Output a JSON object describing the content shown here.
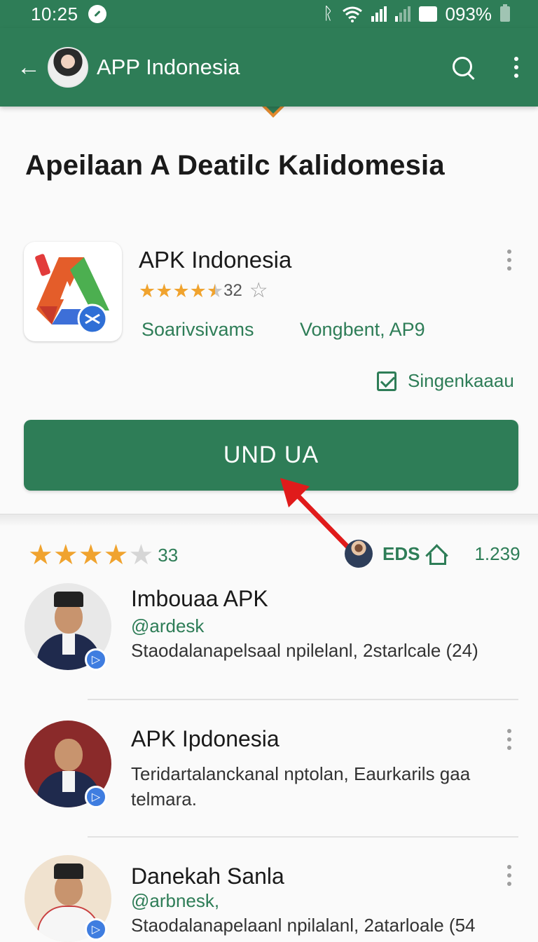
{
  "status_bar": {
    "time": "10:25",
    "battery": "093%",
    "icons": [
      "sync-icon",
      "bluetooth-icon",
      "wifi-icon",
      "signal-icon",
      "battery-icon"
    ]
  },
  "app_bar": {
    "back_icon": "arrow-left-icon",
    "title": "APP Indonesia",
    "search_icon": "search-icon",
    "menu_icon": "more-vert-icon"
  },
  "page": {
    "heading": "Apeilaan A Deatilc Kalidomesia"
  },
  "app": {
    "name": "APK Indonesia",
    "rating_count": "32",
    "rating": 4.5,
    "category": "Soarivsivams",
    "version": "Vongbent, AP9",
    "verified_label": "Singenkaaau",
    "install_label": "UND UA"
  },
  "summary": {
    "rating": 4,
    "count": "33",
    "label": "EDS",
    "total": "1.239"
  },
  "reviews": [
    {
      "name": "Imbouaa APK",
      "handle": "@ardesk",
      "desc": "Staodalanapelsaal npilelanl, 2starlcale (24)"
    },
    {
      "name": "APK Ipdonesia",
      "handle": "",
      "desc": "Teridartalanckanal nptolan, Eaurkarils gaa telmara."
    },
    {
      "name": "Danekah Sanla",
      "handle": "@arbnesk,",
      "desc": "Staodalanapelaanl npilalanl, 2atarloale (54"
    }
  ],
  "colors": {
    "primary": "#2e7d57",
    "star": "#f0a32e",
    "accent_arrow": "#e01b1b",
    "badge": "#3f7de0"
  }
}
